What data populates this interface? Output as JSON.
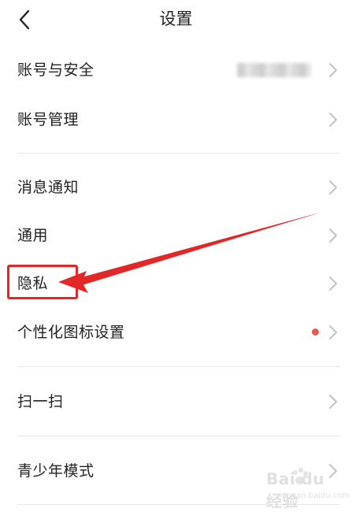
{
  "header": {
    "title": "设置",
    "back_icon": "chevron-left-icon"
  },
  "settings": {
    "account_security": {
      "label": "账号与安全",
      "value": "(blurred)"
    },
    "account_manage": {
      "label": "账号管理"
    },
    "notifications": {
      "label": "消息通知"
    },
    "general": {
      "label": "通用"
    },
    "privacy": {
      "label": "隐私"
    },
    "icon_settings": {
      "label": "个性化图标设置",
      "badge_color": "#e55a4e"
    },
    "scan": {
      "label": "扫一扫"
    },
    "youth_mode": {
      "label": "青少年模式"
    }
  },
  "annotation": {
    "color": "#e32727",
    "target": "隐私"
  },
  "watermark": {
    "text": "Bai du 经验",
    "sub": "jingyan.baidu.com"
  },
  "colors": {
    "text": "#222222",
    "divider": "#e6e6e6",
    "chevron": "#bbbbbb"
  }
}
